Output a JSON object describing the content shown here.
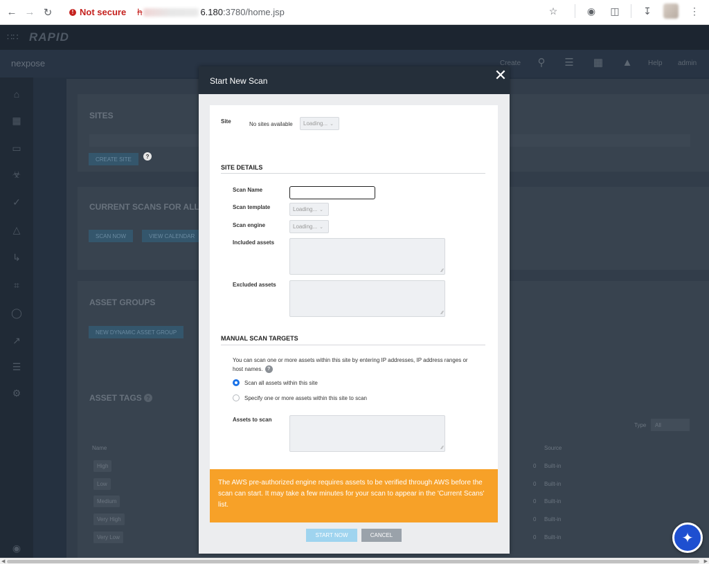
{
  "browser": {
    "security_label": "Not secure",
    "url_struck": "h",
    "url_host": "6.180",
    "url_path": ":3780/home.jsp"
  },
  "app": {
    "brand": "RAPID",
    "product": "nexpose",
    "header": {
      "create": "Create",
      "help": "Help",
      "user": "admin"
    },
    "sections": {
      "sites_title": "SITES",
      "create_site": "CREATE SITE",
      "current_scans_title": "CURRENT SCANS FOR ALL SITES",
      "scan_now": "SCAN NOW",
      "view_calendar": "VIEW CALENDAR",
      "asset_groups_title": "ASSET GROUPS",
      "new_dynamic_group": "NEW DYNAMIC ASSET GROUP",
      "asset_tags_title": "ASSET TAGS",
      "type_label": "Type",
      "type_value": "All",
      "col_name": "Name",
      "col_source": "Source",
      "tags": [
        {
          "name": "High",
          "count": "0",
          "source": "Built-in"
        },
        {
          "name": "Low",
          "count": "0",
          "source": "Built-in"
        },
        {
          "name": "Medium",
          "count": "0",
          "source": "Built-in"
        },
        {
          "name": "Very High",
          "count": "0",
          "source": "Built-in"
        },
        {
          "name": "Very Low",
          "count": "0",
          "source": "Built-in"
        }
      ]
    }
  },
  "modal": {
    "title": "Start New Scan",
    "site_label": "Site",
    "site_value": "No sites available",
    "site_select": "Loading...",
    "site_details_head": "SITE DETAILS",
    "scan_name_label": "Scan Name",
    "scan_name_value": "",
    "scan_template_label": "Scan template",
    "scan_template_value": "Loading...",
    "scan_engine_label": "Scan engine",
    "scan_engine_value": "Loading...",
    "included_assets_label": "Included assets",
    "excluded_assets_label": "Excluded assets",
    "manual_targets_head": "MANUAL SCAN TARGETS",
    "manual_targets_help": "You can scan one or more assets within this site by entering IP addresses, IP address ranges or host names.",
    "radio_all": "Scan all assets within this site",
    "radio_specify": "Specify one or more assets within this site to scan",
    "assets_to_scan_label": "Assets to scan",
    "warning": "The AWS pre-authorized engine requires assets to be verified through AWS before the scan can start. It may take a few minutes for your scan to appear in the 'Current Scans' list.",
    "start_now": "START NOW",
    "cancel": "CANCEL"
  }
}
